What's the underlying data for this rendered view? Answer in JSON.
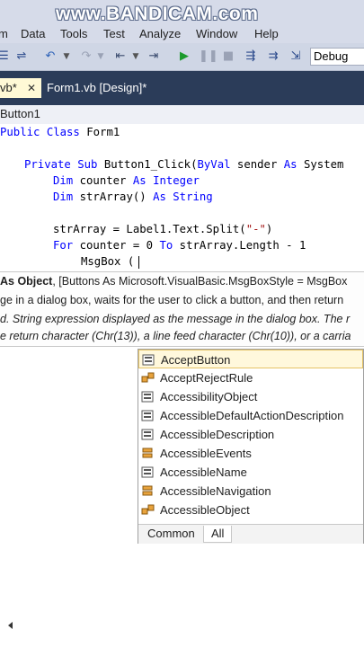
{
  "watermark": {
    "text": "www.BANDICAM.com"
  },
  "menu": [
    "m",
    "Data",
    "Tools",
    "Test",
    "Analyze",
    "Window",
    "Help"
  ],
  "toolbar": {
    "config": "Debug"
  },
  "tabs": {
    "tab1": "vb*",
    "tab1_close": "✕",
    "tab2": "Form1.vb [Design]*"
  },
  "navbar": {
    "left": "Button1"
  },
  "code": {
    "l1_kw": "Public Class",
    "l1_rest": " Form1",
    "l2_kw1": "Private Sub",
    "l2_rest": " Button1_Click(",
    "l2_kw2": "ByVal",
    "l2_rest2": " sender ",
    "l2_kw3": "As",
    "l2_rest3": " System",
    "l3_kw1": "Dim",
    "l3_rest": " counter ",
    "l3_kw2": "As Integer",
    "l4_kw1": "Dim",
    "l4_rest": " strArray() ",
    "l4_kw2": "As String",
    "l5_rest": "strArray = Label1.Text.Split(",
    "l5_str": "\"-\"",
    "l5_end": ")",
    "l6_kw1": "For",
    "l6_rest": " counter = 0 ",
    "l6_kw2": "To",
    "l6_rest2": " strArray.Length - 1",
    "l7": "MsgBox ("
  },
  "tooltip": {
    "line1_bold": "As Object",
    "line1_rest": ", [Buttons As Microsoft.VisualBasic.MsgBoxStyle = MsgBox",
    "line2": "ge in a dialog box, waits for the user to click a button, and then return",
    "line3": "d. String expression displayed as the message in the dialog box. The r",
    "line4": "e return character (Chr(13)), a line feed character (Chr(10)), or a carria"
  },
  "intellisense": {
    "items": [
      {
        "label": "AcceptButton",
        "icon": "property-icon"
      },
      {
        "label": "AcceptRejectRule",
        "icon": "class-icon"
      },
      {
        "label": "AccessibilityObject",
        "icon": "property-icon"
      },
      {
        "label": "AccessibleDefaultActionDescription",
        "icon": "property-icon"
      },
      {
        "label": "AccessibleDescription",
        "icon": "property-icon"
      },
      {
        "label": "AccessibleEvents",
        "icon": "enum-icon"
      },
      {
        "label": "AccessibleName",
        "icon": "property-icon"
      },
      {
        "label": "AccessibleNavigation",
        "icon": "enum-icon"
      },
      {
        "label": "AccessibleObject",
        "icon": "class-icon"
      }
    ],
    "tab_common": "Common",
    "tab_all": "All"
  },
  "colors": {
    "keyword": "#0000ff",
    "type": "#2b91af",
    "string": "#a31515",
    "tabstrip": "#2b3c59"
  }
}
